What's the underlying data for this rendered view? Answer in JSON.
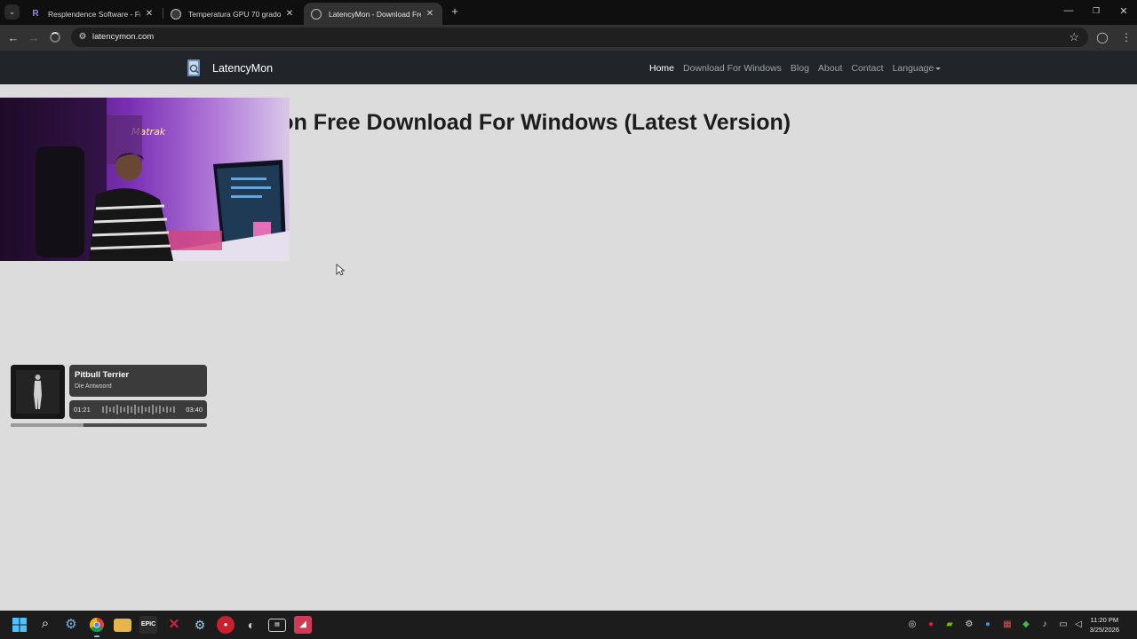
{
  "browser": {
    "tabs": [
      {
        "title": "Resplendence Software - Free D",
        "active": false
      },
      {
        "title": "Temperatura GPU 70 grados",
        "active": false
      },
      {
        "title": "LatencyMon - Download Free D",
        "active": true
      }
    ],
    "new_tab": "+",
    "window_controls": {
      "minimize": "—",
      "restore": "❐",
      "close": "✕"
    },
    "back_icon": "←",
    "forward_icon": "→",
    "url": "latencymon.com",
    "bookmark_icon": "☆",
    "profile_icon": "◯",
    "menu_icon": "⋮"
  },
  "site": {
    "brand": "LatencyMon",
    "nav": [
      {
        "label": "Home",
        "active": true
      },
      {
        "label": "Download For Windows",
        "active": false
      },
      {
        "label": "Blog",
        "active": false
      },
      {
        "label": "About",
        "active": false
      },
      {
        "label": "Contact",
        "active": false
      },
      {
        "label": "Language",
        "active": false,
        "dropdown": true
      }
    ],
    "heading": "LatencyMon Free Download For Windows (Latest Version)"
  },
  "now_playing": {
    "title": "Pitbull Terrier",
    "artist": "Die Antwoord",
    "current_time": "01:21",
    "total_time": "03:40",
    "progress": 0.37
  },
  "taskbar": {
    "time": "11:20 PM",
    "date": "3/25/2026"
  },
  "colors": {
    "page_bg": "#dcdcdc",
    "navbar_bg": "#212529",
    "chrome_bg": "#0f0f0f",
    "toolbar_bg": "#323232",
    "taskbar_bg": "#1c1c1c"
  }
}
